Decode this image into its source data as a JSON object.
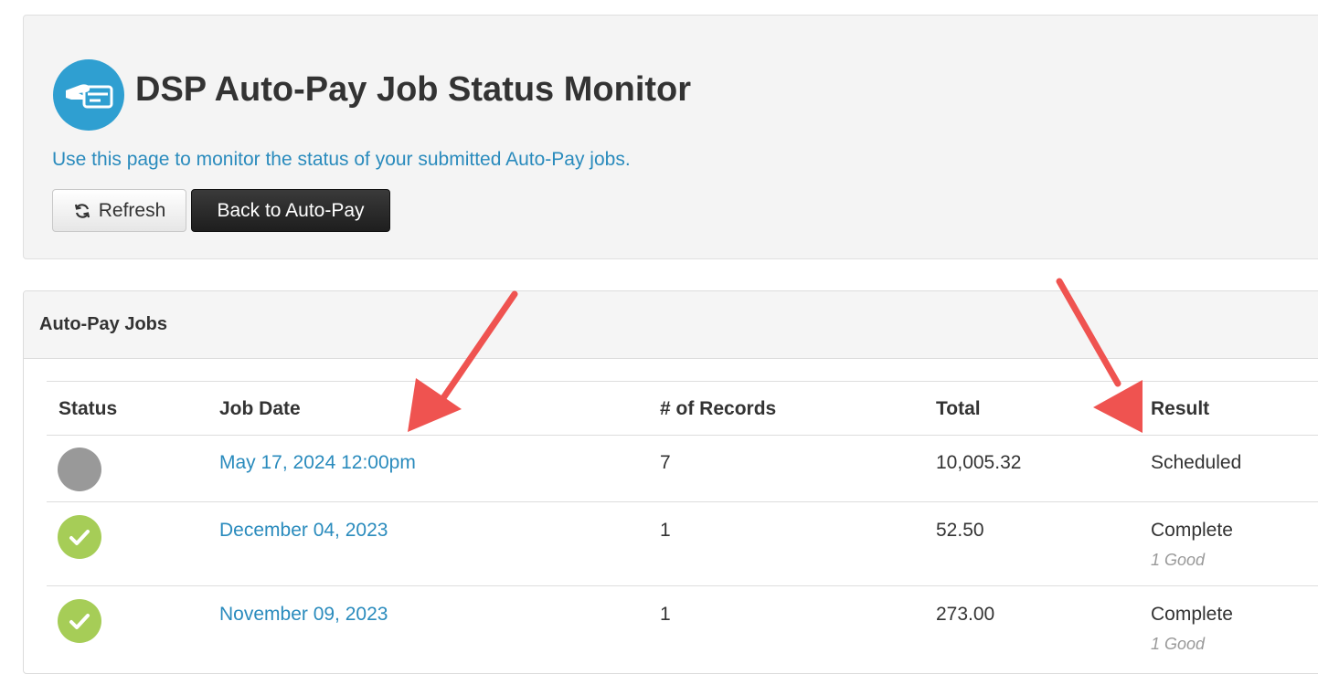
{
  "header": {
    "title": "DSP Auto-Pay Job Status Monitor",
    "subtitle": "Use this page to monitor the status of your submitted Auto-Pay jobs.",
    "logo_icon": "payment-hand-card-icon",
    "refresh_label": "Refresh",
    "refresh_icon": "refresh-icon",
    "back_label": "Back to Auto-Pay"
  },
  "jobs_panel": {
    "heading": "Auto-Pay Jobs",
    "columns": [
      "Status",
      "Job Date",
      "# of Records",
      "Total",
      "Result"
    ],
    "rows": [
      {
        "status": "scheduled",
        "status_color": "#999999",
        "job_date": "May 17, 2024 12:00pm",
        "records": "7",
        "total": "10,005.32",
        "result": "Scheduled",
        "result_detail": ""
      },
      {
        "status": "complete",
        "status_color": "#a6cd57",
        "job_date": "December 04, 2023",
        "records": "1",
        "total": "52.50",
        "result": "Complete",
        "result_detail": "1 Good"
      },
      {
        "status": "complete",
        "status_color": "#a6cd57",
        "job_date": "November 09, 2023",
        "records": "1",
        "total": "273.00",
        "result": "Complete",
        "result_detail": "1 Good"
      }
    ]
  },
  "colors": {
    "link": "#2a8bbd",
    "logo": "#2f9fd1",
    "annotation_arrow": "#ef5350"
  }
}
